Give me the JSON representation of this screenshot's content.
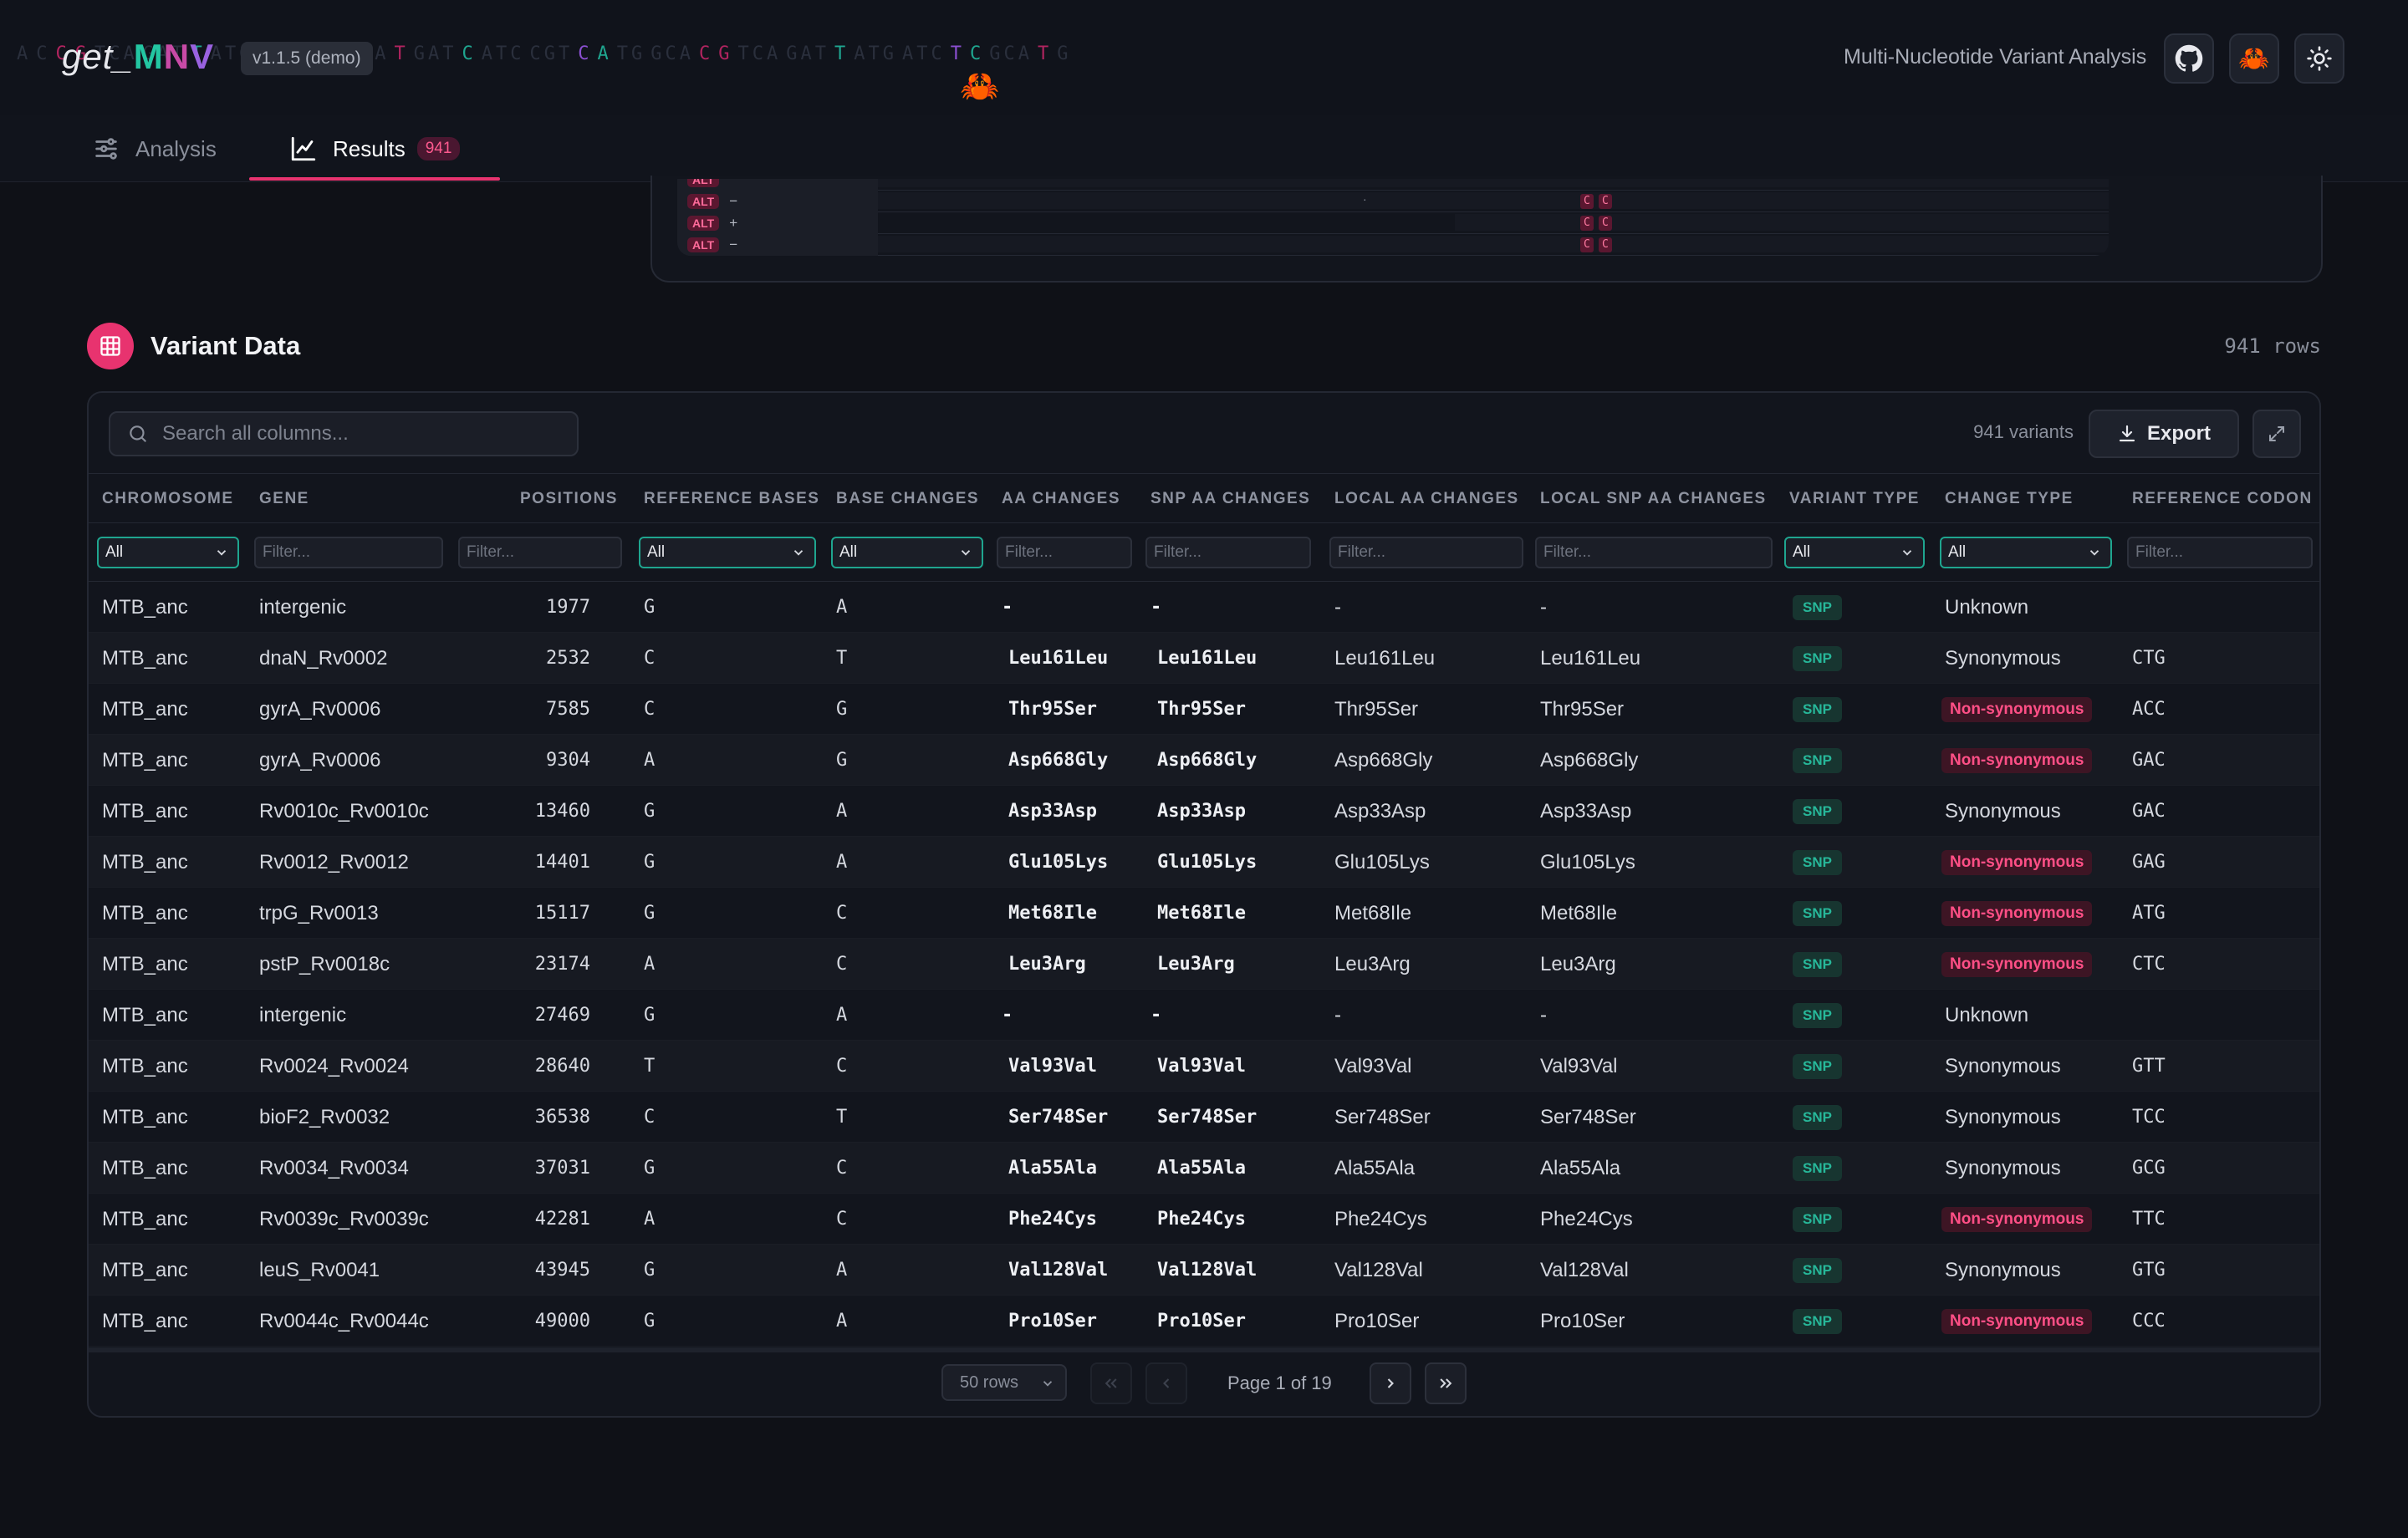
{
  "header": {
    "logo": {
      "prefix": "get_",
      "m": "M",
      "n": "N",
      "v": "V"
    },
    "version": "v1.1.5 (demo)",
    "subtitle": "Multi-Nucleotide Variant Analysis",
    "buttons": [
      "github-icon",
      "crab-icon",
      "sun-icon"
    ]
  },
  "tabs": [
    {
      "label": "Analysis",
      "icon": "sliders-icon",
      "active": false
    },
    {
      "label": "Results",
      "icon": "chart-line-icon",
      "active": true,
      "badge": "941"
    }
  ],
  "alignment_preview": {
    "rows": [
      {
        "tag": "ALT",
        "strand": "−"
      },
      {
        "tag": "ALT",
        "strand": "+"
      },
      {
        "tag": "ALT",
        "strand": "−"
      }
    ],
    "bases": [
      "C",
      "C"
    ]
  },
  "section": {
    "title": "Variant Data",
    "rows_label": "941 rows"
  },
  "toolbar": {
    "search_placeholder": "Search all columns...",
    "count_label": "941 variants",
    "export_label": "Export"
  },
  "columns": [
    "CHROMOSOME",
    "GENE",
    "POSITIONS",
    "REFERENCE BASES",
    "BASE CHANGES",
    "AA CHANGES",
    "SNP AA CHANGES",
    "LOCAL AA CHANGES",
    "LOCAL SNP AA CHANGES",
    "VARIANT TYPE",
    "CHANGE TYPE",
    "REFERENCE CODON"
  ],
  "filters": {
    "select_value": "All",
    "input_placeholder": "Filter..."
  },
  "rows": [
    {
      "chrom": "MTB_anc",
      "gene": "intergenic",
      "pos": "1977",
      "ref": "G",
      "base": "A",
      "aa": "-",
      "snp_aa": "-",
      "local_aa": "-",
      "local_snp_aa": "-",
      "vtype": "SNP",
      "ctype": "Unknown",
      "codon": ""
    },
    {
      "chrom": "MTB_anc",
      "gene": "dnaN_Rv0002",
      "pos": "2532",
      "ref": "C",
      "base": "T",
      "aa": "Leu161Leu",
      "snp_aa": "Leu161Leu",
      "local_aa": "Leu161Leu",
      "local_snp_aa": "Leu161Leu",
      "vtype": "SNP",
      "ctype": "Synonymous",
      "codon": "CTG"
    },
    {
      "chrom": "MTB_anc",
      "gene": "gyrA_Rv0006",
      "pos": "7585",
      "ref": "C",
      "base": "G",
      "aa": "Thr95Ser",
      "snp_aa": "Thr95Ser",
      "local_aa": "Thr95Ser",
      "local_snp_aa": "Thr95Ser",
      "vtype": "SNP",
      "ctype": "Non-synonymous",
      "codon": "ACC"
    },
    {
      "chrom": "MTB_anc",
      "gene": "gyrA_Rv0006",
      "pos": "9304",
      "ref": "A",
      "base": "G",
      "aa": "Asp668Gly",
      "snp_aa": "Asp668Gly",
      "local_aa": "Asp668Gly",
      "local_snp_aa": "Asp668Gly",
      "vtype": "SNP",
      "ctype": "Non-synonymous",
      "codon": "GAC"
    },
    {
      "chrom": "MTB_anc",
      "gene": "Rv0010c_Rv0010c",
      "pos": "13460",
      "ref": "G",
      "base": "A",
      "aa": "Asp33Asp",
      "snp_aa": "Asp33Asp",
      "local_aa": "Asp33Asp",
      "local_snp_aa": "Asp33Asp",
      "vtype": "SNP",
      "ctype": "Synonymous",
      "codon": "GAC"
    },
    {
      "chrom": "MTB_anc",
      "gene": "Rv0012_Rv0012",
      "pos": "14401",
      "ref": "G",
      "base": "A",
      "aa": "Glu105Lys",
      "snp_aa": "Glu105Lys",
      "local_aa": "Glu105Lys",
      "local_snp_aa": "Glu105Lys",
      "vtype": "SNP",
      "ctype": "Non-synonymous",
      "codon": "GAG"
    },
    {
      "chrom": "MTB_anc",
      "gene": "trpG_Rv0013",
      "pos": "15117",
      "ref": "G",
      "base": "C",
      "aa": "Met68Ile",
      "snp_aa": "Met68Ile",
      "local_aa": "Met68Ile",
      "local_snp_aa": "Met68Ile",
      "vtype": "SNP",
      "ctype": "Non-synonymous",
      "codon": "ATG"
    },
    {
      "chrom": "MTB_anc",
      "gene": "pstP_Rv0018c",
      "pos": "23174",
      "ref": "A",
      "base": "C",
      "aa": "Leu3Arg",
      "snp_aa": "Leu3Arg",
      "local_aa": "Leu3Arg",
      "local_snp_aa": "Leu3Arg",
      "vtype": "SNP",
      "ctype": "Non-synonymous",
      "codon": "CTC"
    },
    {
      "chrom": "MTB_anc",
      "gene": "intergenic",
      "pos": "27469",
      "ref": "G",
      "base": "A",
      "aa": "-",
      "snp_aa": "-",
      "local_aa": "-",
      "local_snp_aa": "-",
      "vtype": "SNP",
      "ctype": "Unknown",
      "codon": ""
    },
    {
      "chrom": "MTB_anc",
      "gene": "Rv0024_Rv0024",
      "pos": "28640",
      "ref": "T",
      "base": "C",
      "aa": "Val93Val",
      "snp_aa": "Val93Val",
      "local_aa": "Val93Val",
      "local_snp_aa": "Val93Val",
      "vtype": "SNP",
      "ctype": "Synonymous",
      "codon": "GTT"
    },
    {
      "chrom": "MTB_anc",
      "gene": "bioF2_Rv0032",
      "pos": "36538",
      "ref": "C",
      "base": "T",
      "aa": "Ser748Ser",
      "snp_aa": "Ser748Ser",
      "local_aa": "Ser748Ser",
      "local_snp_aa": "Ser748Ser",
      "vtype": "SNP",
      "ctype": "Synonymous",
      "codon": "TCC"
    },
    {
      "chrom": "MTB_anc",
      "gene": "Rv0034_Rv0034",
      "pos": "37031",
      "ref": "G",
      "base": "C",
      "aa": "Ala55Ala",
      "snp_aa": "Ala55Ala",
      "local_aa": "Ala55Ala",
      "local_snp_aa": "Ala55Ala",
      "vtype": "SNP",
      "ctype": "Synonymous",
      "codon": "GCG"
    },
    {
      "chrom": "MTB_anc",
      "gene": "Rv0039c_Rv0039c",
      "pos": "42281",
      "ref": "A",
      "base": "C",
      "aa": "Phe24Cys",
      "snp_aa": "Phe24Cys",
      "local_aa": "Phe24Cys",
      "local_snp_aa": "Phe24Cys",
      "vtype": "SNP",
      "ctype": "Non-synonymous",
      "codon": "TTC"
    },
    {
      "chrom": "MTB_anc",
      "gene": "leuS_Rv0041",
      "pos": "43945",
      "ref": "G",
      "base": "A",
      "aa": "Val128Val",
      "snp_aa": "Val128Val",
      "local_aa": "Val128Val",
      "local_snp_aa": "Val128Val",
      "vtype": "SNP",
      "ctype": "Synonymous",
      "codon": "GTG"
    },
    {
      "chrom": "MTB_anc",
      "gene": "Rv0044c_Rv0044c",
      "pos": "49000",
      "ref": "G",
      "base": "A",
      "aa": "Pro10Ser",
      "snp_aa": "Pro10Ser",
      "local_aa": "Pro10Ser",
      "local_snp_aa": "Pro10Ser",
      "vtype": "SNP",
      "ctype": "Non-synonymous",
      "codon": "CCC"
    }
  ],
  "pagination": {
    "rows_per_page": "50 rows",
    "page_label": "Page 1 of 19"
  },
  "colors": {
    "accent": "#e8336f",
    "snp": "#27b89a",
    "non_synonymous": "#ff4f86",
    "background": "#0f1117"
  }
}
